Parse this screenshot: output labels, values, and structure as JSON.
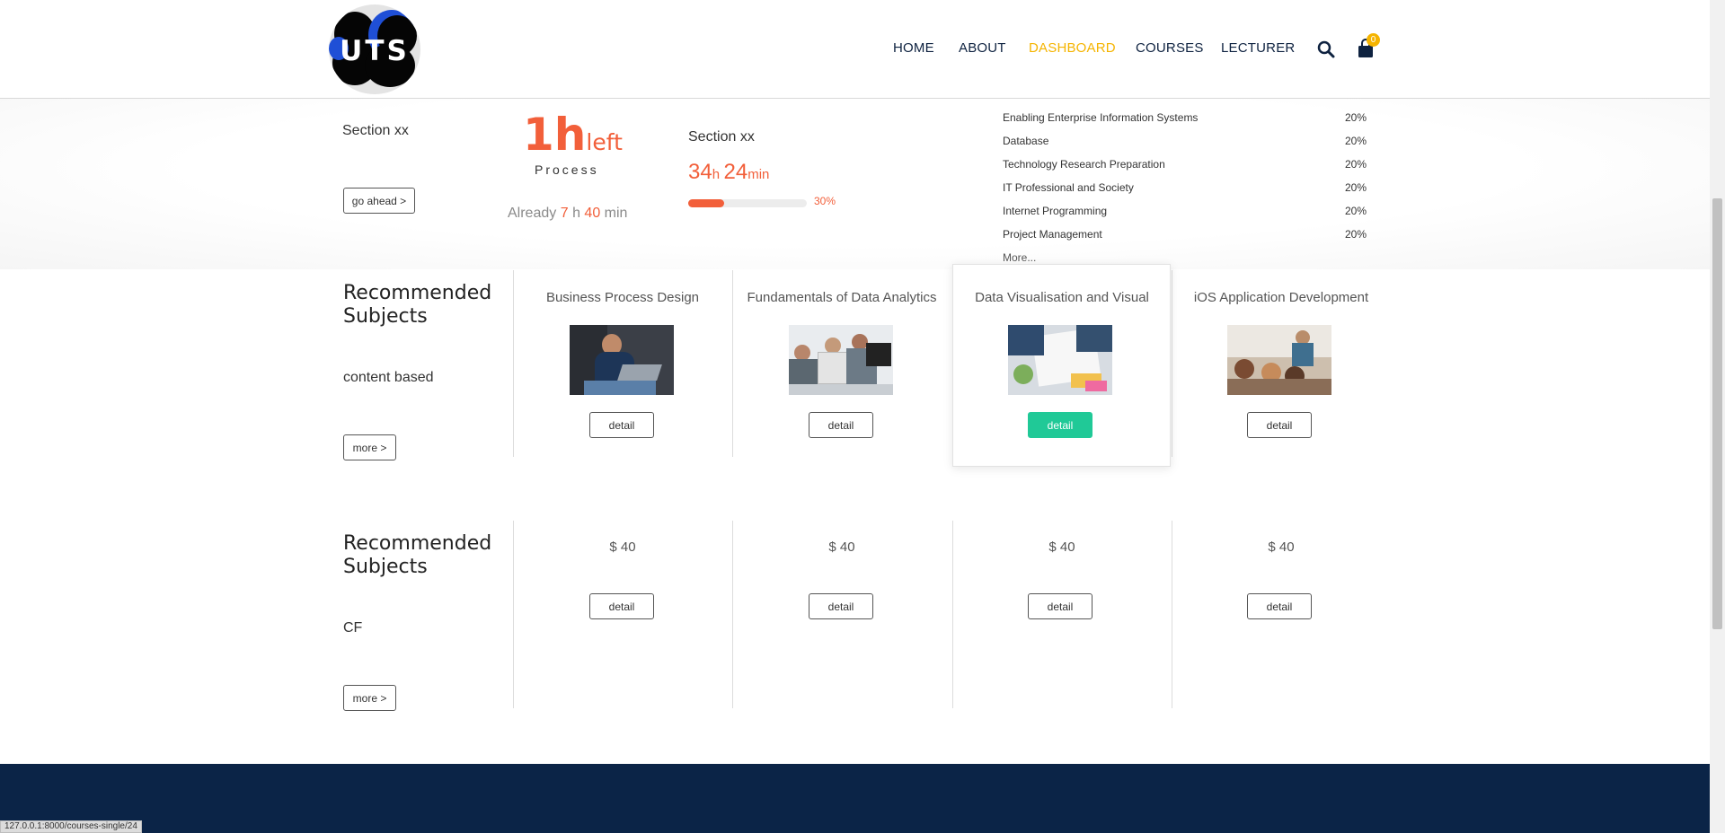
{
  "header": {
    "logo_text": "UTS",
    "nav": [
      {
        "label": "HOME"
      },
      {
        "label": "ABOUT"
      },
      {
        "label": "DASHBOARD"
      },
      {
        "label": "COURSES"
      },
      {
        "label": "LECTURER"
      }
    ],
    "active_nav": "DASHBOARD",
    "cart_count": "0",
    "accent_color": "#f5b400"
  },
  "progress": {
    "left_section": {
      "label": "Section xx",
      "button": "go ahead >"
    },
    "time_left": {
      "value": "1",
      "unit": "h",
      "suffix": "left",
      "caption": "Process"
    },
    "already": {
      "prefix": "Already",
      "hours": "7",
      "h": "h",
      "minutes": "40",
      "min": "min"
    },
    "right_section": {
      "label": "Section xx",
      "hours": "34",
      "h": "h",
      "minutes": "24",
      "min": "min",
      "percent_text": "30%",
      "percent": 0.3
    },
    "accent_color": "#f25f3a"
  },
  "subjects": {
    "items": [
      {
        "name": "Enabling Enterprise Information Systems",
        "pct": "20%"
      },
      {
        "name": "Database",
        "pct": "20%"
      },
      {
        "name": "Technology Research Preparation",
        "pct": "20%"
      },
      {
        "name": "IT Professional and Society",
        "pct": "20%"
      },
      {
        "name": "Internet Programming",
        "pct": "20%"
      },
      {
        "name": "Project Management",
        "pct": "20%"
      }
    ],
    "more": "More..."
  },
  "rec_content": {
    "title_line1": "Recommended",
    "title_line2": "Subjects",
    "subtitle": "content based",
    "more": "more >",
    "courses": [
      {
        "name": "Business Process Design",
        "button": "detail"
      },
      {
        "name": "Fundamentals of Data Analytics",
        "button": "detail"
      },
      {
        "name": "Data Visualisation and Visual",
        "button": "detail"
      },
      {
        "name": "iOS Application Development",
        "button": "detail"
      }
    ],
    "active_button_color": "#20c997"
  },
  "rec_cf": {
    "title_line1": "Recommended",
    "title_line2": "Subjects",
    "subtitle": "CF",
    "more": "more >",
    "items": [
      {
        "price": "$ 40",
        "button": "detail"
      },
      {
        "price": "$ 40",
        "button": "detail"
      },
      {
        "price": "$ 40",
        "button": "detail"
      },
      {
        "price": "$ 40",
        "button": "detail"
      }
    ]
  },
  "footer": {
    "color": "#0b2447"
  },
  "status_url": "127.0.0.1:8000/courses-single/24"
}
